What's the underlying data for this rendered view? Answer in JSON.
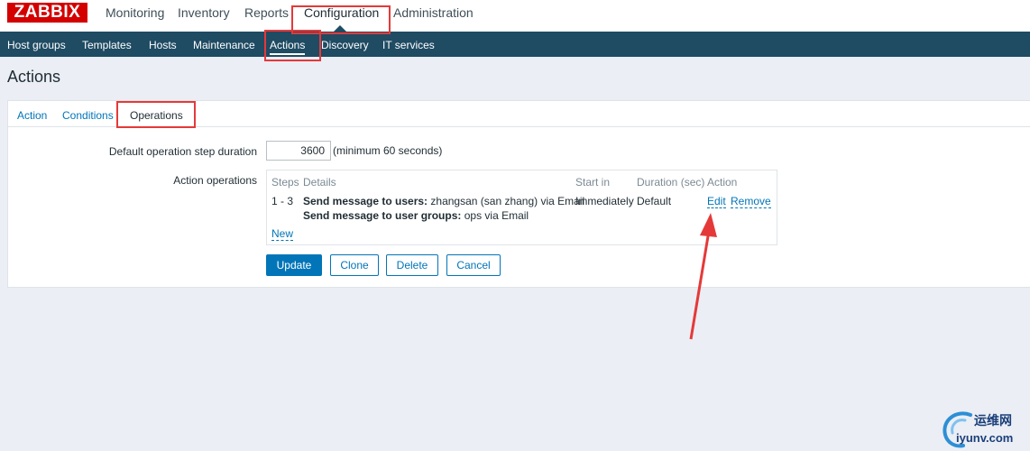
{
  "brand": {
    "logo_text": "ZABBIX"
  },
  "top_nav": {
    "items": [
      {
        "label": "Monitoring"
      },
      {
        "label": "Inventory"
      },
      {
        "label": "Reports"
      },
      {
        "label": "Configuration"
      },
      {
        "label": "Administration"
      }
    ],
    "active": "Configuration"
  },
  "sub_nav": {
    "items": [
      {
        "label": "Host groups"
      },
      {
        "label": "Templates"
      },
      {
        "label": "Hosts"
      },
      {
        "label": "Maintenance"
      },
      {
        "label": "Actions"
      },
      {
        "label": "Discovery"
      },
      {
        "label": "IT services"
      }
    ],
    "active": "Actions"
  },
  "page": {
    "title": "Actions"
  },
  "tabs": [
    {
      "label": "Action"
    },
    {
      "label": "Conditions"
    },
    {
      "label": "Operations"
    }
  ],
  "active_tab": "Operations",
  "form": {
    "step_duration_label": "Default operation step duration",
    "step_duration_value": "3600",
    "step_duration_hint": "(minimum 60 seconds)",
    "action_operations_label": "Action operations"
  },
  "operations_table": {
    "headers": [
      "Steps",
      "Details",
      "Start in",
      "Duration (sec)",
      "Action"
    ],
    "rows": [
      {
        "steps": "1 - 3",
        "detail_1_bold": "Send message to users:",
        "detail_1_rest": "zhangsan (san zhang) via Email",
        "detail_2_bold": "Send message to user groups:",
        "detail_2_rest": "ops via Email",
        "start_in": "Immediately",
        "duration": "Default",
        "edit_label": "Edit",
        "remove_label": "Remove"
      }
    ],
    "new_label": "New"
  },
  "buttons": {
    "update": "Update",
    "clone": "Clone",
    "delete": "Delete",
    "cancel": "Cancel"
  },
  "watermark": {
    "cn": "运维网",
    "en": "iyunv.com"
  },
  "colors": {
    "brand_red": "#d40000",
    "nav_dark": "#1f4b63",
    "link_blue": "#0275b8",
    "annotation_red": "#e53939"
  }
}
